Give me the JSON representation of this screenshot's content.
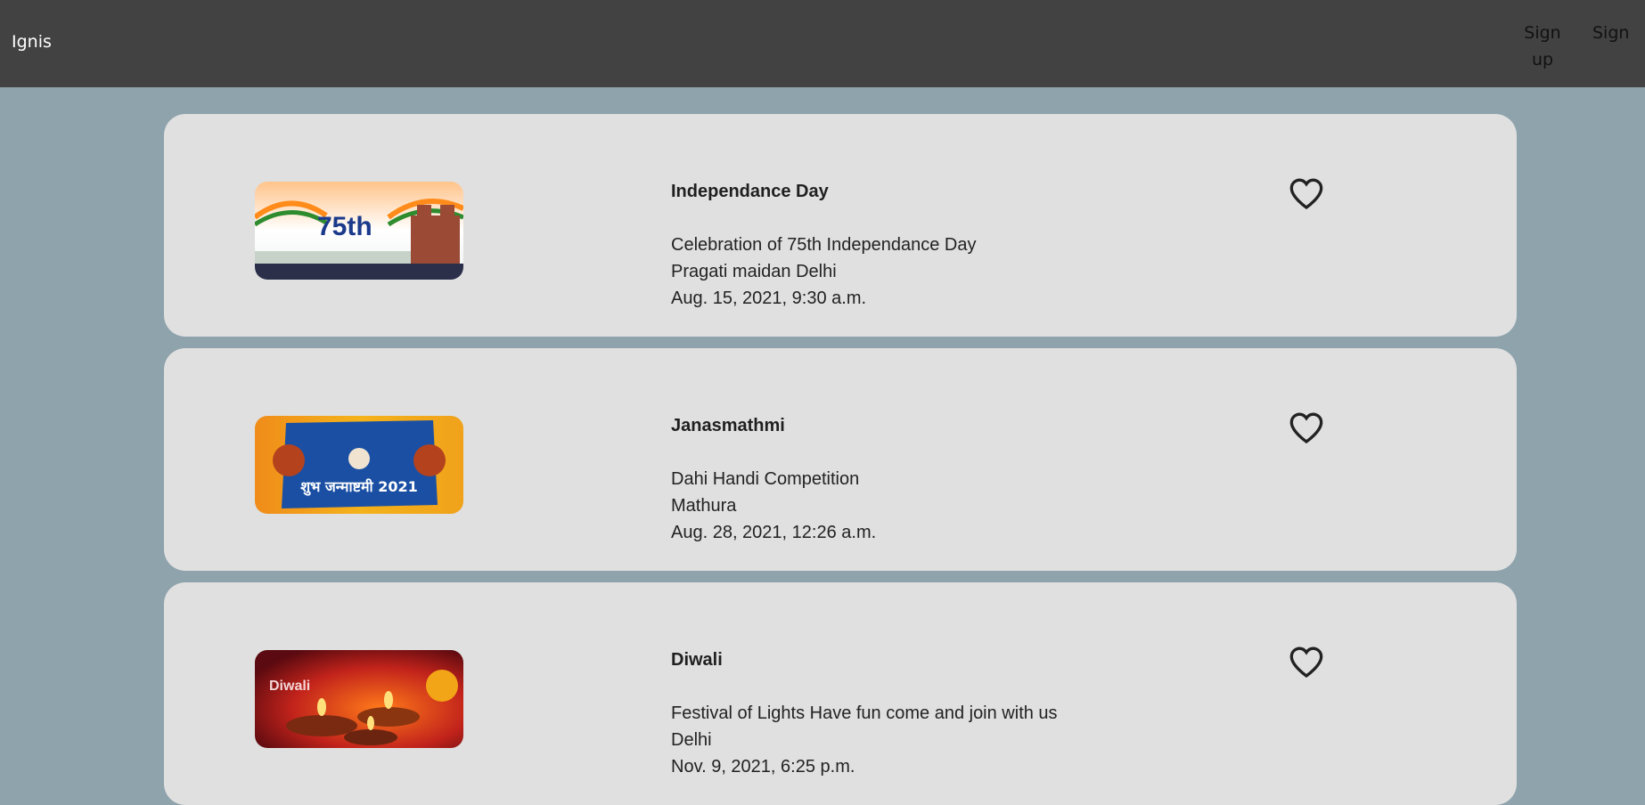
{
  "navbar": {
    "brand": "Ignis",
    "signup_label": "Sign up",
    "signin_label": "Sign"
  },
  "events": [
    {
      "title": "Independance Day",
      "description": "Celebration of 75th Independance Day",
      "location": "Pragati maidan Delhi",
      "datetime": "Aug. 15, 2021, 9:30 a.m.",
      "image_text": "75th",
      "image_icon": "independence-day-banner"
    },
    {
      "title": "Janasmathmi",
      "description": "Dahi Handi Competition",
      "location": "Mathura",
      "datetime": "Aug. 28, 2021, 12:26 a.m.",
      "image_text": "शुभ जन्माष्टमी 2021",
      "image_icon": "janmashtami-banner"
    },
    {
      "title": "Diwali",
      "description": "Festival of Lights Have fun come and join with us",
      "location": "Delhi",
      "datetime": "Nov. 9, 2021, 6:25 p.m.",
      "image_text": "Diwali",
      "image_icon": "diwali-banner"
    }
  ],
  "colors": {
    "navbar": "#424242",
    "page_bg": "#8fa3ac",
    "card_bg": "#e0e0e0"
  }
}
